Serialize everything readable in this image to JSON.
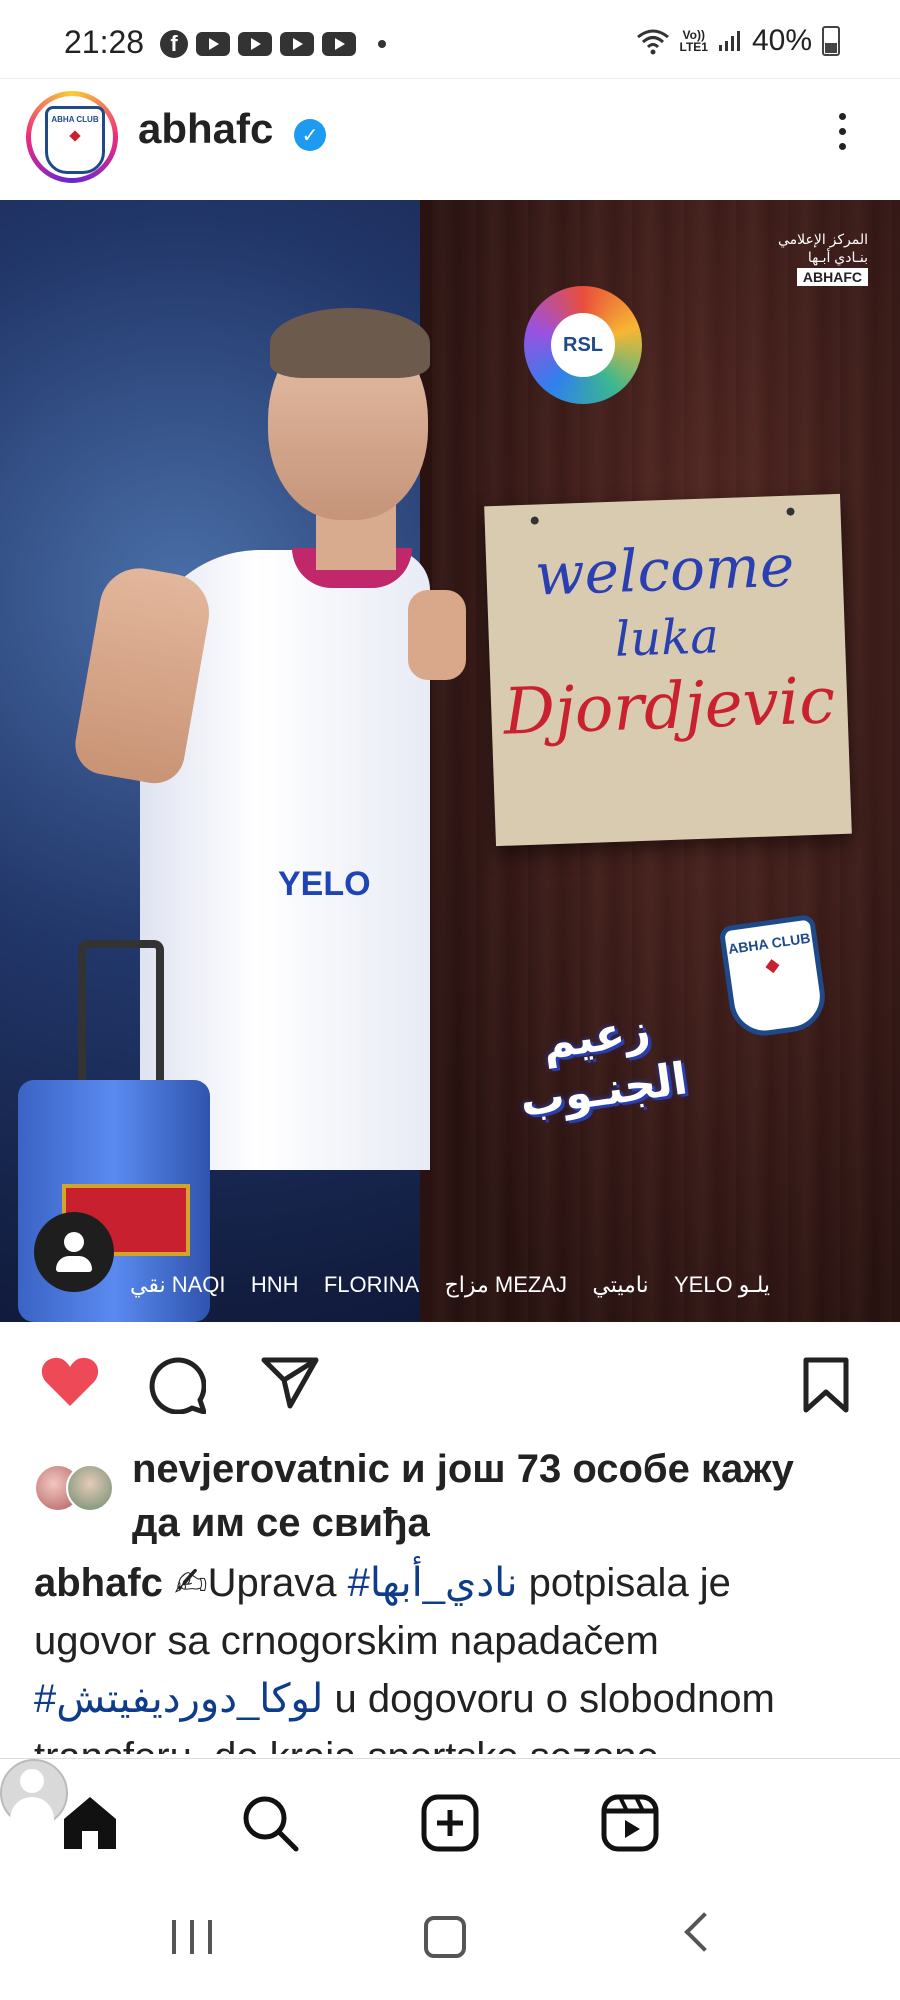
{
  "status_bar": {
    "time": "21:28",
    "network_top": "Vo))",
    "network_bottom": "LTE1",
    "battery": "40%"
  },
  "post": {
    "username": "abhafc",
    "avatar_text": "ABHA CLUB",
    "image": {
      "media_center_arabic": "المركز الإعلامي\nبنـادي أبـها",
      "media_center_latin": "ABHAFC",
      "league_badge": "RSL",
      "sign_line1": "welcome",
      "sign_line2": "luka",
      "sign_line3": "Djordjevic",
      "club_badge": "ABHA CLUB",
      "arabic_slogan": "زعيم الجنـوب",
      "shirt_sponsor": "YELO",
      "sponsors": [
        "نقي NAQI",
        "HNH",
        "FLORINA",
        "مزاج MEZAJ",
        "ناميتي",
        "YELO يلـو"
      ]
    },
    "likes": {
      "text": "nevjerovatnic и још 73 особе кажу да им се свиђа"
    },
    "caption": {
      "username": "abhafc",
      "emoji": "✍",
      "part1": "Uprava ",
      "hashtag1": "#نادي_أبها",
      "part2": " potpisala je ugovor sa crnogorskim napadačem ",
      "hashtag2": "#لوكا_دورديفيتش",
      "part3": " u dogovoru o slobodnom transferu, do kraja sportske sezone"
    }
  },
  "icons": {
    "heart": "heart-icon",
    "comment": "comment-icon",
    "share": "share-icon",
    "save": "bookmark-icon"
  },
  "colors": {
    "heart": "#ed4956",
    "verified": "#1d9bf0",
    "hashtag": "#0f3c8a"
  }
}
